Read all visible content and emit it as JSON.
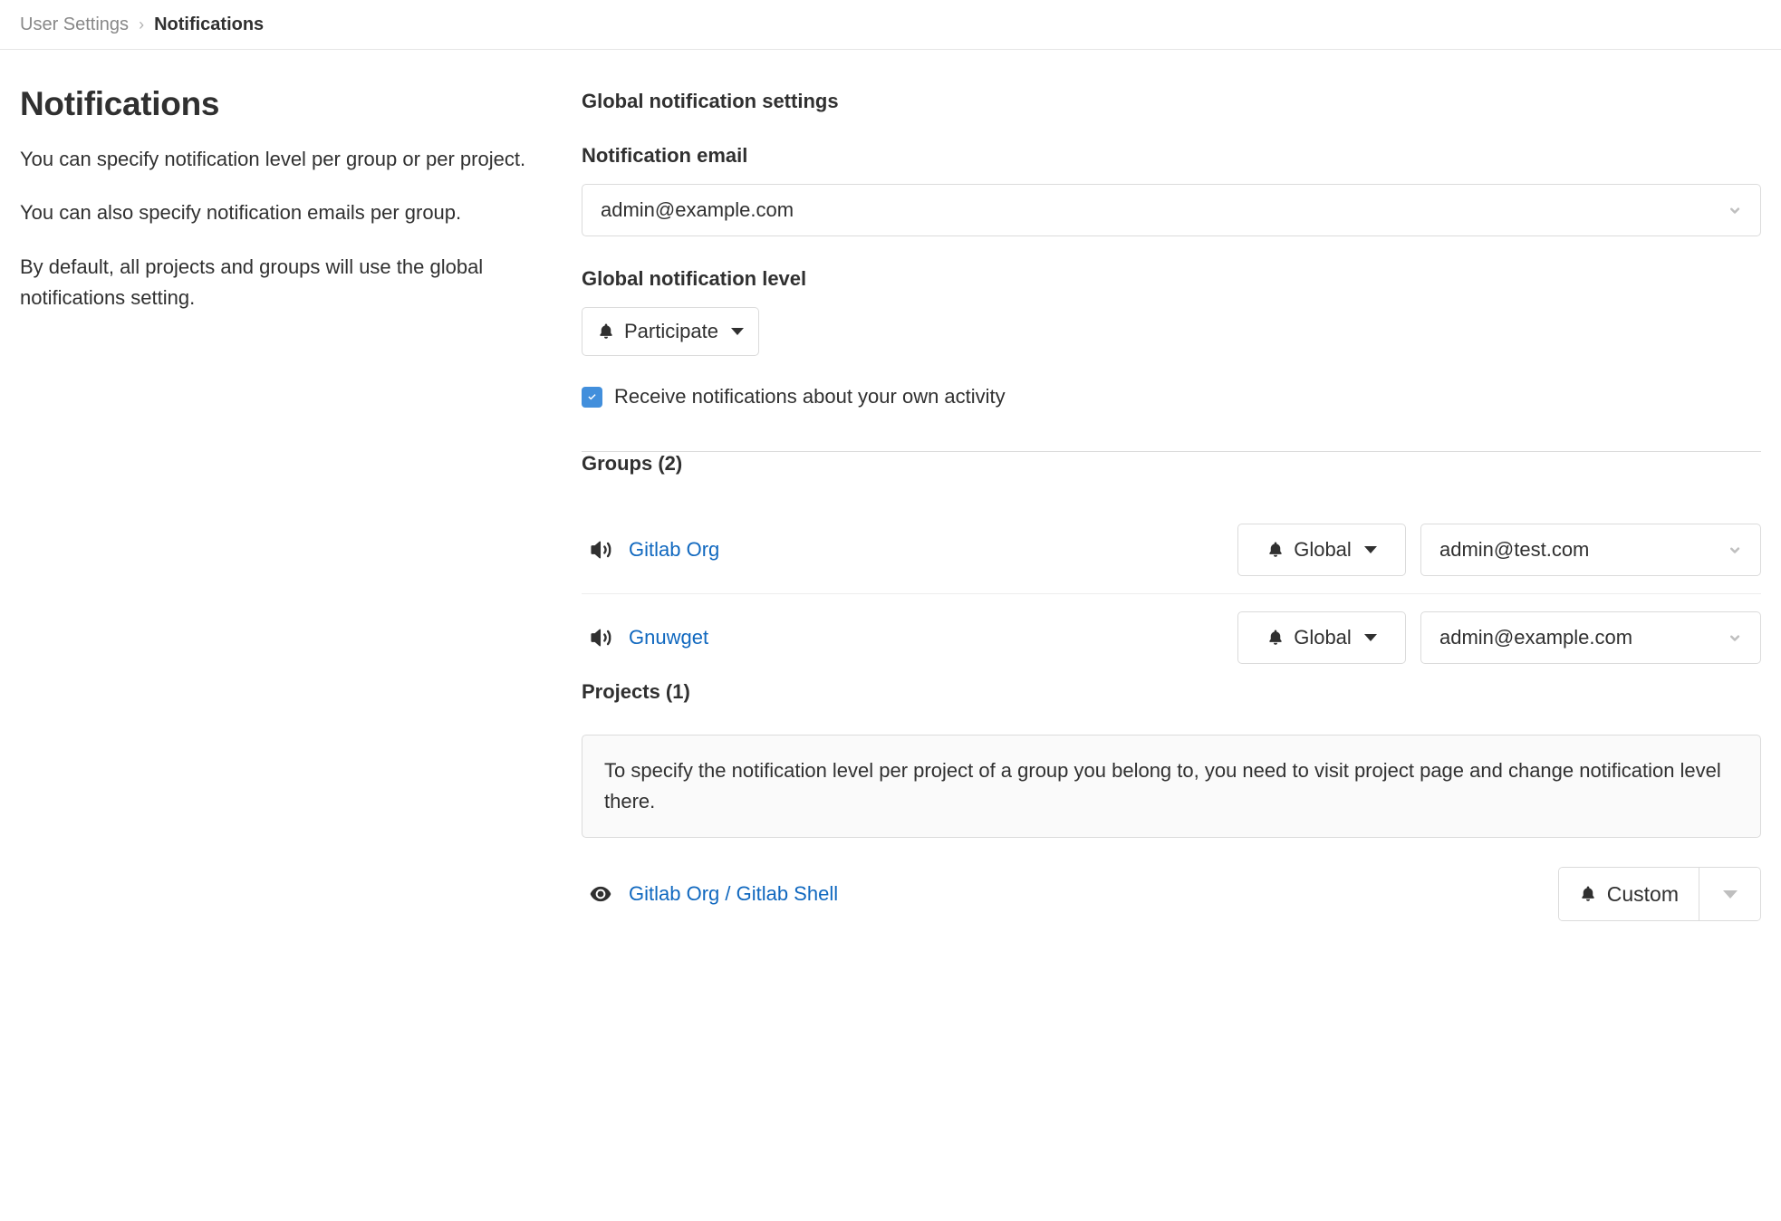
{
  "breadcrumb": {
    "parent": "User Settings",
    "separator": "›",
    "current": "Notifications"
  },
  "sidebar_info": {
    "title": "Notifications",
    "paragraphs": [
      "You can specify notification level per group or per project.",
      "You can also specify notification emails per group.",
      "By default, all projects and groups will use the global notifications setting."
    ]
  },
  "global_settings": {
    "heading": "Global notification settings",
    "email_label": "Notification email",
    "email_value": "admin@example.com",
    "level_label": "Global notification level",
    "level_value": "Participate",
    "own_activity_label": "Receive notifications about your own activity",
    "own_activity_checked": true
  },
  "groups": {
    "heading": "Groups (2)",
    "rows": [
      {
        "icon": "volume-up-icon",
        "name": "Gitlab Org",
        "level": "Global",
        "email": "admin@test.com"
      },
      {
        "icon": "volume-up-icon",
        "name": "Gnuwget",
        "level": "Global",
        "email": "admin@example.com"
      }
    ]
  },
  "projects": {
    "heading": "Projects (1)",
    "info": "To specify the notification level per project of a group you belong to, you need to visit project page and change notification level there.",
    "rows": [
      {
        "icon": "eye-icon",
        "name": "Gitlab Org / Gitlab Shell",
        "level": "Custom"
      }
    ]
  },
  "colors": {
    "link": "#1068bf",
    "checkbox_accent": "#428fdc",
    "border": "#dbdbdb",
    "text": "#303030",
    "muted": "#888888"
  }
}
